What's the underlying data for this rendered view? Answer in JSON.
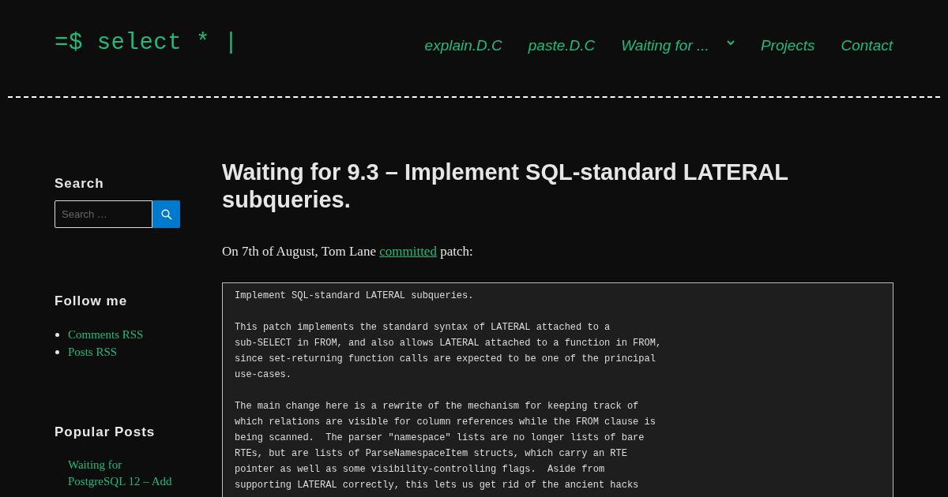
{
  "site_logo": "=$ select * |",
  "nav": [
    {
      "label": "explain.D.C",
      "has_submenu": false
    },
    {
      "label": "paste.D.C",
      "has_submenu": false
    },
    {
      "label": "Waiting for ...",
      "has_submenu": true
    },
    {
      "label": "Projects",
      "has_submenu": false
    },
    {
      "label": "Contact",
      "has_submenu": false
    }
  ],
  "sidebar": {
    "search": {
      "title": "Search",
      "placeholder": "Search …"
    },
    "follow": {
      "title": "Follow me",
      "links": [
        "Comments RSS",
        "Posts RSS"
      ]
    },
    "popular": {
      "title": "Popular Posts",
      "posts": [
        "Waiting for PostgreSQL 12 – Add"
      ]
    }
  },
  "post": {
    "title": "Waiting for 9.3 – Implement SQL-standard LATERAL subqueries.",
    "intro_before": "On 7th of August, Tom Lane",
    "intro_link": "committed",
    "intro_after": "patch:",
    "code_paragraphs": [
      [
        "Implement SQL-standard LATERAL subqueries."
      ],
      [
        "This patch implements the standard syntax of LATERAL attached to a",
        "sub-SELECT in FROM, and also allows LATERAL attached to a function in FROM,",
        "since set-returning function calls are expected to be one of the principal",
        "use-cases."
      ],
      [
        "The main change here is a rewrite of the mechanism for keeping track of",
        "which relations are visible for column references while the FROM clause is",
        "being scanned.  The parser \"namespace\" lists are no longer lists of bare",
        "RTEs, but are lists of ParseNamespaceItem structs, which carry an RTE",
        "pointer as well as some visibility-controlling flags.  Aside from",
        "supporting LATERAL correctly, this lets us get rid of the ancient hacks"
      ]
    ]
  }
}
